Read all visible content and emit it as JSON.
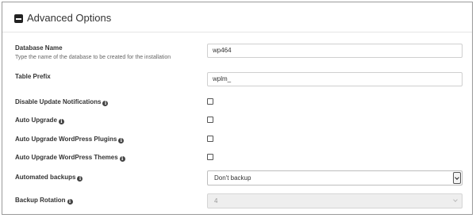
{
  "panel": {
    "title": "Advanced Options",
    "collapse_icon": "minus-square-icon"
  },
  "fields": {
    "database_name": {
      "label": "Database Name",
      "help": "Type the name of the database to be created for the installation",
      "value": "wp464"
    },
    "table_prefix": {
      "label": "Table Prefix",
      "value": "wplm_"
    },
    "disable_update_notifications": {
      "label": "Disable Update Notifications",
      "checked": false
    },
    "auto_upgrade": {
      "label": "Auto Upgrade",
      "checked": false
    },
    "auto_upgrade_plugins": {
      "label": "Auto Upgrade WordPress Plugins",
      "checked": false
    },
    "auto_upgrade_themes": {
      "label": "Auto Upgrade WordPress Themes",
      "checked": false
    },
    "automated_backups": {
      "label": "Automated backups",
      "selected": "Don't backup"
    },
    "backup_rotation": {
      "label": "Backup Rotation",
      "selected": "4",
      "disabled": true
    }
  },
  "icons": {
    "info": "info-circle-icon"
  },
  "info_glyph": "i"
}
